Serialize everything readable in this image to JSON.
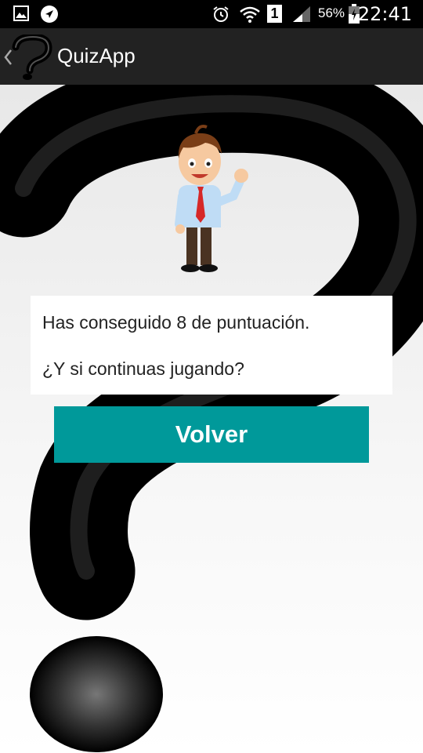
{
  "status_bar": {
    "battery_percent": "56%",
    "time": "22:41",
    "sim_slot": "1",
    "icons": [
      "image-icon",
      "navigation-icon",
      "alarm-icon",
      "wifi-icon",
      "sim-icon",
      "signal-icon",
      "battery-icon"
    ]
  },
  "action_bar": {
    "title": "QuizApp",
    "icons": [
      "back-chevron-icon",
      "question-logo-icon"
    ]
  },
  "result": {
    "score_line": "Has conseguido 8 de puntuación.",
    "prompt_line": "¿Y si continuas jugando?"
  },
  "actions": {
    "back_label": "Volver"
  },
  "colors": {
    "accent": "#00999a",
    "action_bar": "#222222",
    "status_bar": "#000000"
  }
}
